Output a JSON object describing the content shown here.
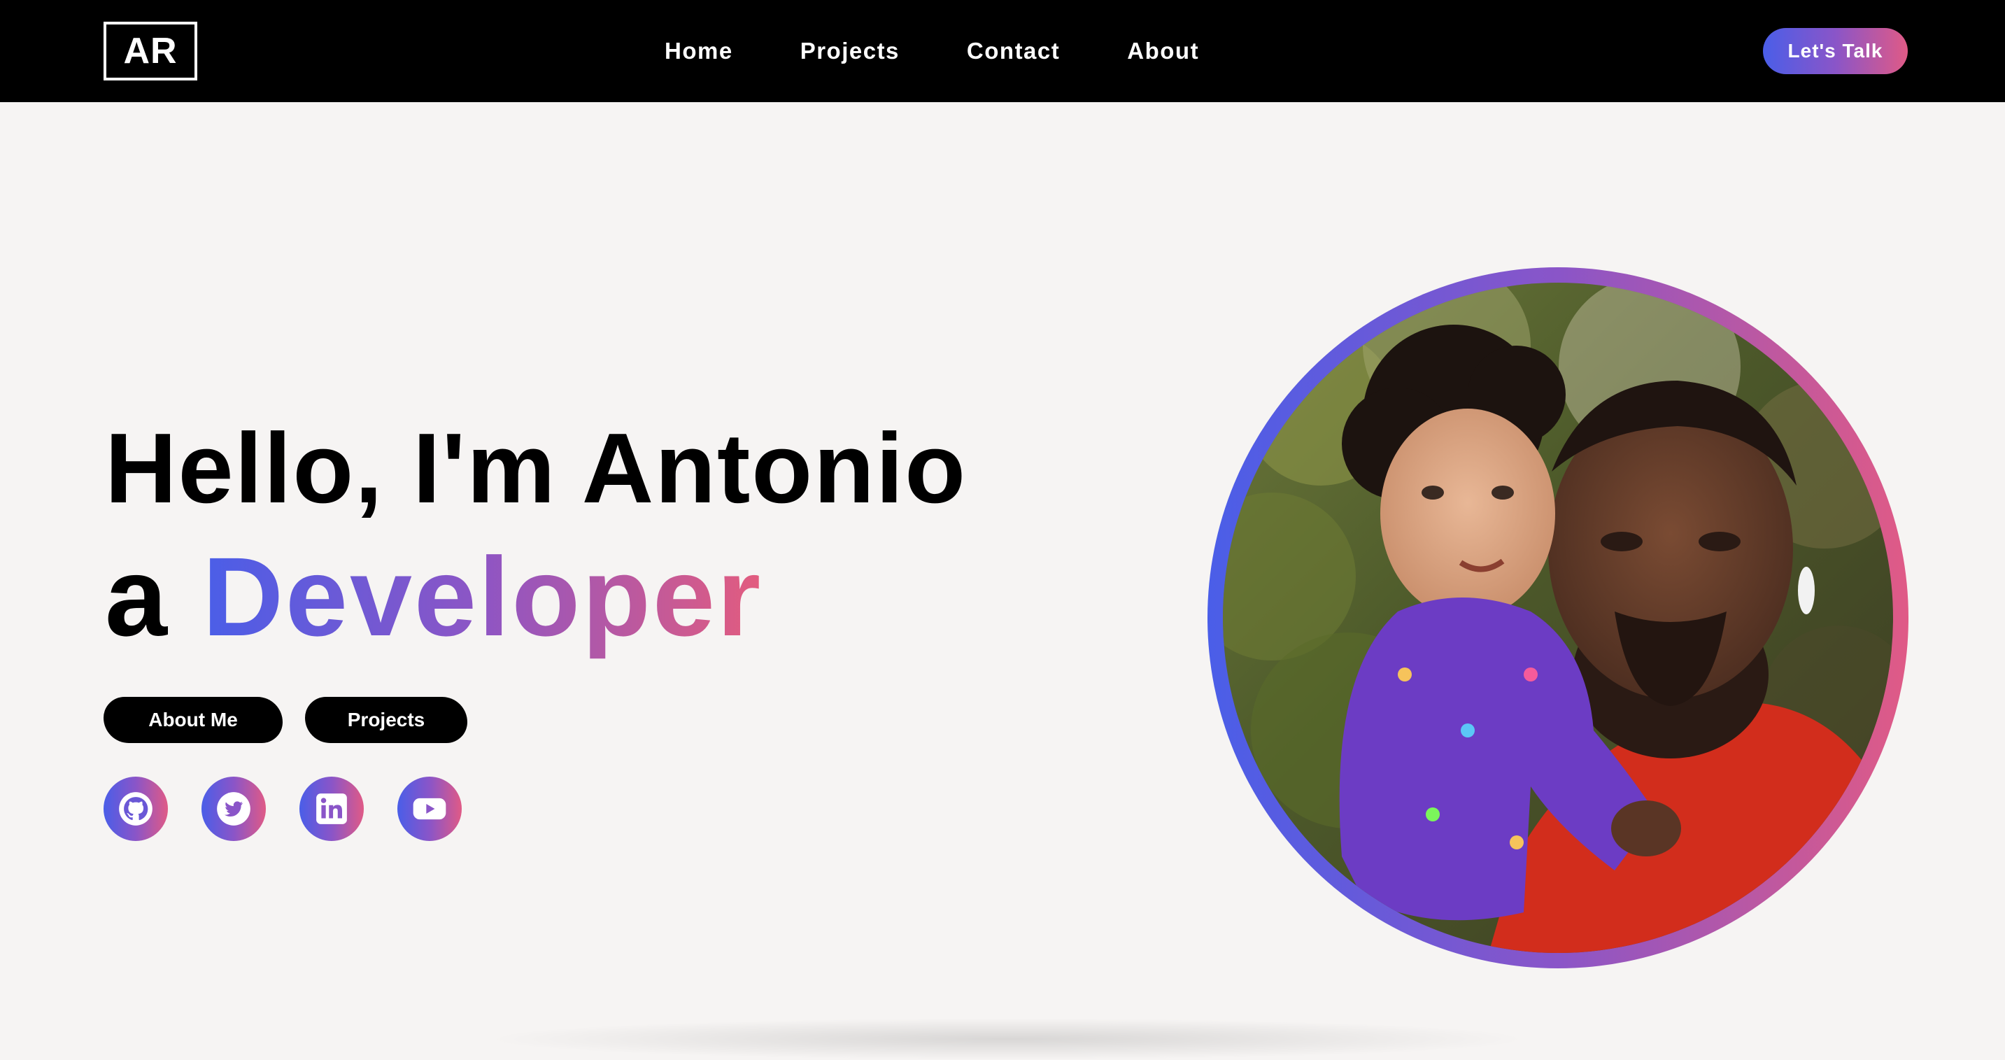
{
  "navbar": {
    "logo": "AR",
    "links": [
      "Home",
      "Projects",
      "Contact",
      "About"
    ],
    "cta_label": "Let's Talk"
  },
  "hero": {
    "title": "Hello, I'm Antonio",
    "subtitle_prefix": "a ",
    "subtitle_highlight": "Developer",
    "buttons": {
      "about_me": "About Me",
      "projects": "Projects"
    },
    "socials": [
      "github-icon",
      "twitter-icon",
      "linkedin-icon",
      "youtube-icon"
    ]
  },
  "colors": {
    "gradient_start": "#4a5ee8",
    "gradient_mid": "#8a55c8",
    "gradient_end": "#e05a86",
    "navbar_bg": "#000000",
    "page_bg": "#f6f4f3"
  }
}
